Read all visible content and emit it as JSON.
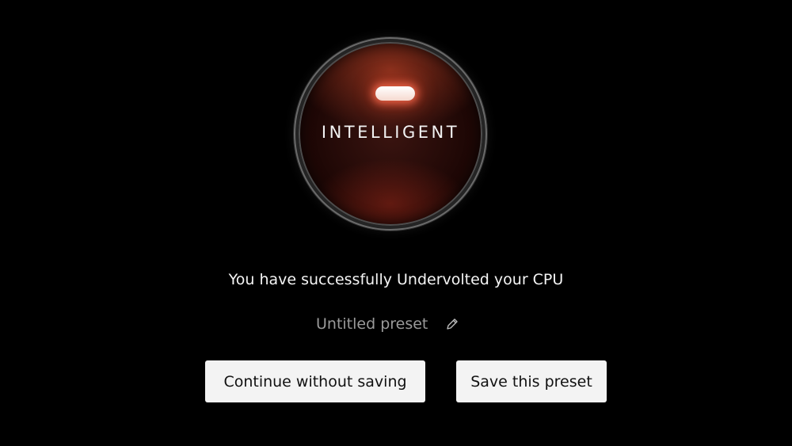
{
  "dial": {
    "label": "INTELLIGENT",
    "glow_color": "#ff6e50"
  },
  "message": {
    "text": "You have successfully Undervolted your CPU"
  },
  "preset": {
    "name": "Untitled preset",
    "edit_icon": "pencil-icon"
  },
  "actions": {
    "continue_label": "Continue without saving",
    "save_label": "Save this preset"
  },
  "colors": {
    "background": "#000000",
    "button_bg": "#f3f3f3",
    "muted_text": "#9a9a9a"
  }
}
